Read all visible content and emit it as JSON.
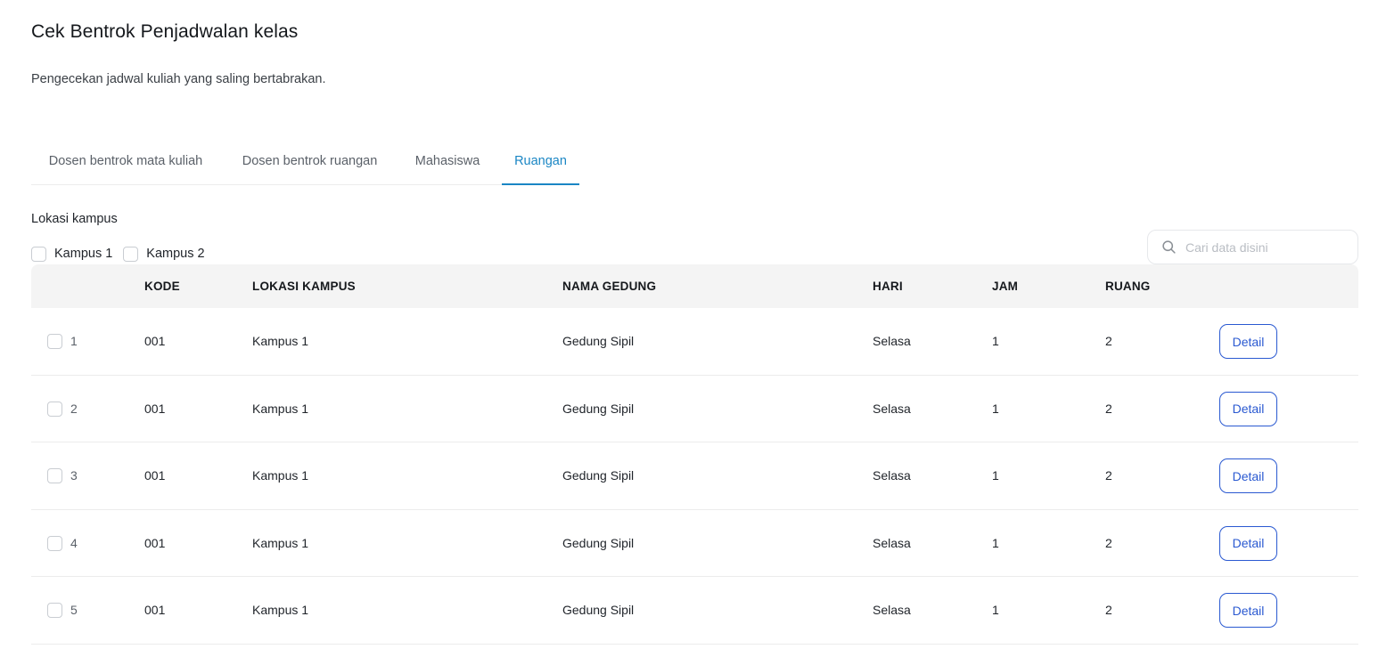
{
  "header": {
    "title": "Cek Bentrok Penjadwalan kelas",
    "subtitle": "Pengecekan jadwal kuliah yang saling bertabrakan."
  },
  "tabs": [
    {
      "label": "Dosen bentrok mata kuliah",
      "active": false
    },
    {
      "label": "Dosen bentrok ruangan",
      "active": false
    },
    {
      "label": "Mahasiswa",
      "active": false
    },
    {
      "label": "Ruangan",
      "active": true
    }
  ],
  "filter": {
    "label": "Lokasi kampus",
    "options": [
      "Kampus 1",
      "Kampus 2"
    ]
  },
  "search": {
    "placeholder": "Cari data disini",
    "icon": "search-icon"
  },
  "table": {
    "columns": [
      "KODE",
      "LOKASI KAMPUS",
      "NAMA GEDUNG",
      "HARI",
      "JAM",
      "RUANG"
    ],
    "action_label": "Detail",
    "rows": [
      {
        "no": "1",
        "kode": "001",
        "lokasi": "Kampus 1",
        "gedung": "Gedung Sipil",
        "hari": "Selasa",
        "jam": "1",
        "ruang": "2"
      },
      {
        "no": "2",
        "kode": "001",
        "lokasi": "Kampus 1",
        "gedung": "Gedung Sipil",
        "hari": "Selasa",
        "jam": "1",
        "ruang": "2"
      },
      {
        "no": "3",
        "kode": "001",
        "lokasi": "Kampus 1",
        "gedung": "Gedung Sipil",
        "hari": "Selasa",
        "jam": "1",
        "ruang": "2"
      },
      {
        "no": "4",
        "kode": "001",
        "lokasi": "Kampus 1",
        "gedung": "Gedung Sipil",
        "hari": "Selasa",
        "jam": "1",
        "ruang": "2"
      },
      {
        "no": "5",
        "kode": "001",
        "lokasi": "Kampus 1",
        "gedung": "Gedung Sipil",
        "hari": "Selasa",
        "jam": "1",
        "ruang": "2"
      }
    ]
  },
  "colors": {
    "accent": "#1a86c4",
    "button": "#2a59d1",
    "header_bg": "#f4f4f4"
  }
}
